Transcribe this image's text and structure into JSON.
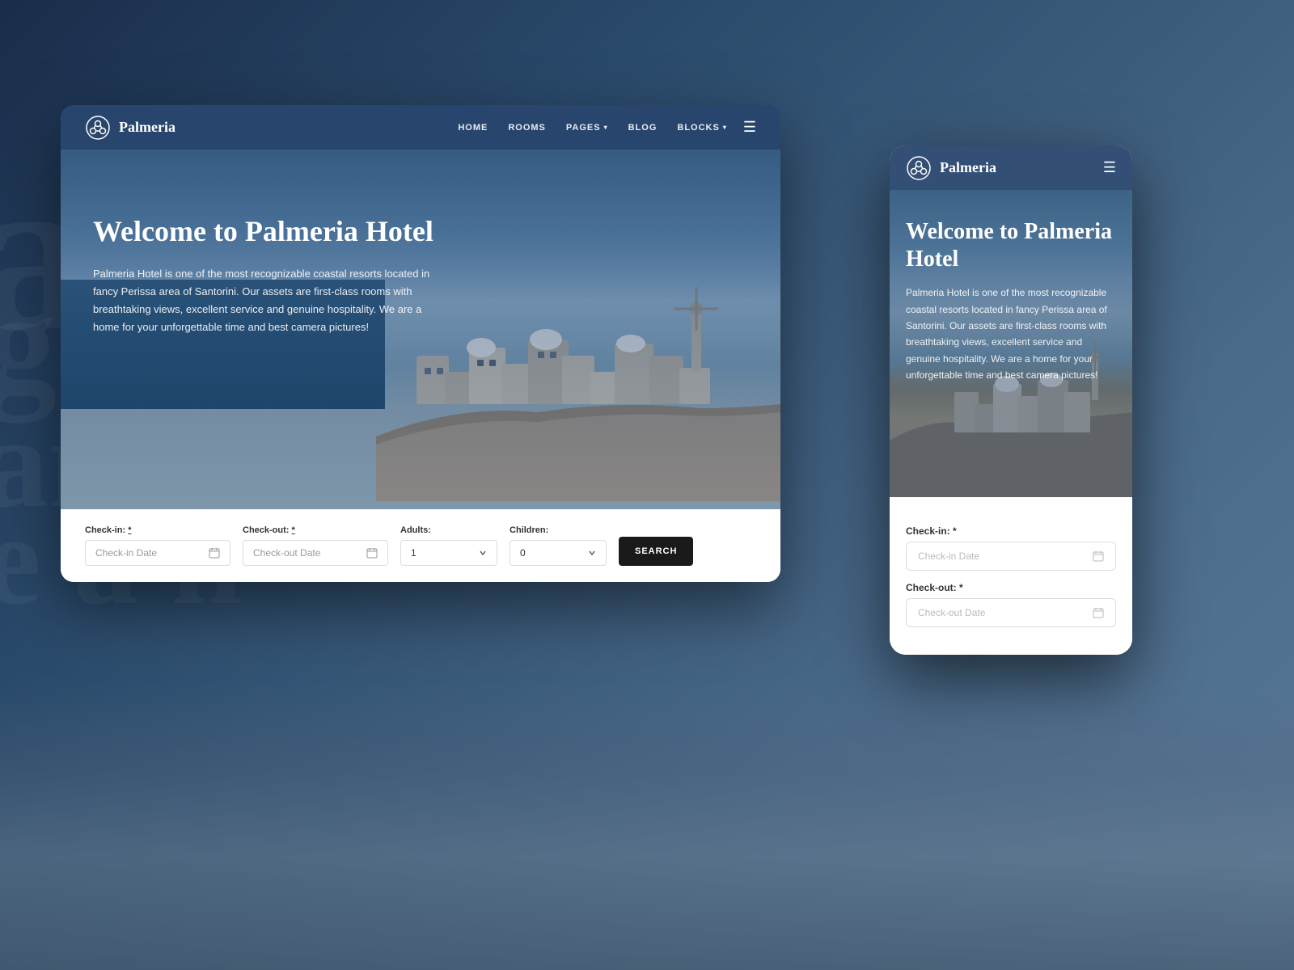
{
  "background": {
    "blur_texts": [
      "alm",
      "gniza",
      "ans d",
      "e a h"
    ]
  },
  "desktop": {
    "nav": {
      "logo_text": "Palmeria",
      "links": [
        "HOME",
        "ROOMS",
        "PAGES",
        "BLOG",
        "BLOCKS"
      ]
    },
    "hero": {
      "title": "Welcome to Palmeria Hotel",
      "description": "Palmeria Hotel is one of the most recognizable coastal resorts located in fancy Perissa area of Santorini. Our assets are first-class rooms with breathtaking views, excellent service and genuine hospitality. We are a home for your unforgettable time and best camera pictures!"
    },
    "booking": {
      "checkin_label": "Check-in:",
      "checkin_required": "*",
      "checkin_placeholder": "Check-in Date",
      "checkout_label": "Check-out:",
      "checkout_required": "*",
      "checkout_placeholder": "Check-out Date",
      "adults_label": "Adults:",
      "adults_value": "1",
      "children_label": "Children:",
      "children_value": "0",
      "search_btn": "SEARCH"
    }
  },
  "mobile": {
    "nav": {
      "logo_text": "Palmeria"
    },
    "hero": {
      "title": "Welcome to Palmeria Hotel",
      "description": "Palmeria Hotel is one of the most recognizable coastal resorts located in fancy Perissa area of Santorini. Our assets are first-class rooms with breathtaking views, excellent service and genuine hospitality. We are a home for your unforgettable time and best camera pictures!"
    },
    "booking": {
      "checkin_label": "Check-in: *",
      "checkin_placeholder": "Check-in Date",
      "checkout_label": "Check-out: *",
      "checkout_placeholder": "Check-out Date"
    }
  }
}
